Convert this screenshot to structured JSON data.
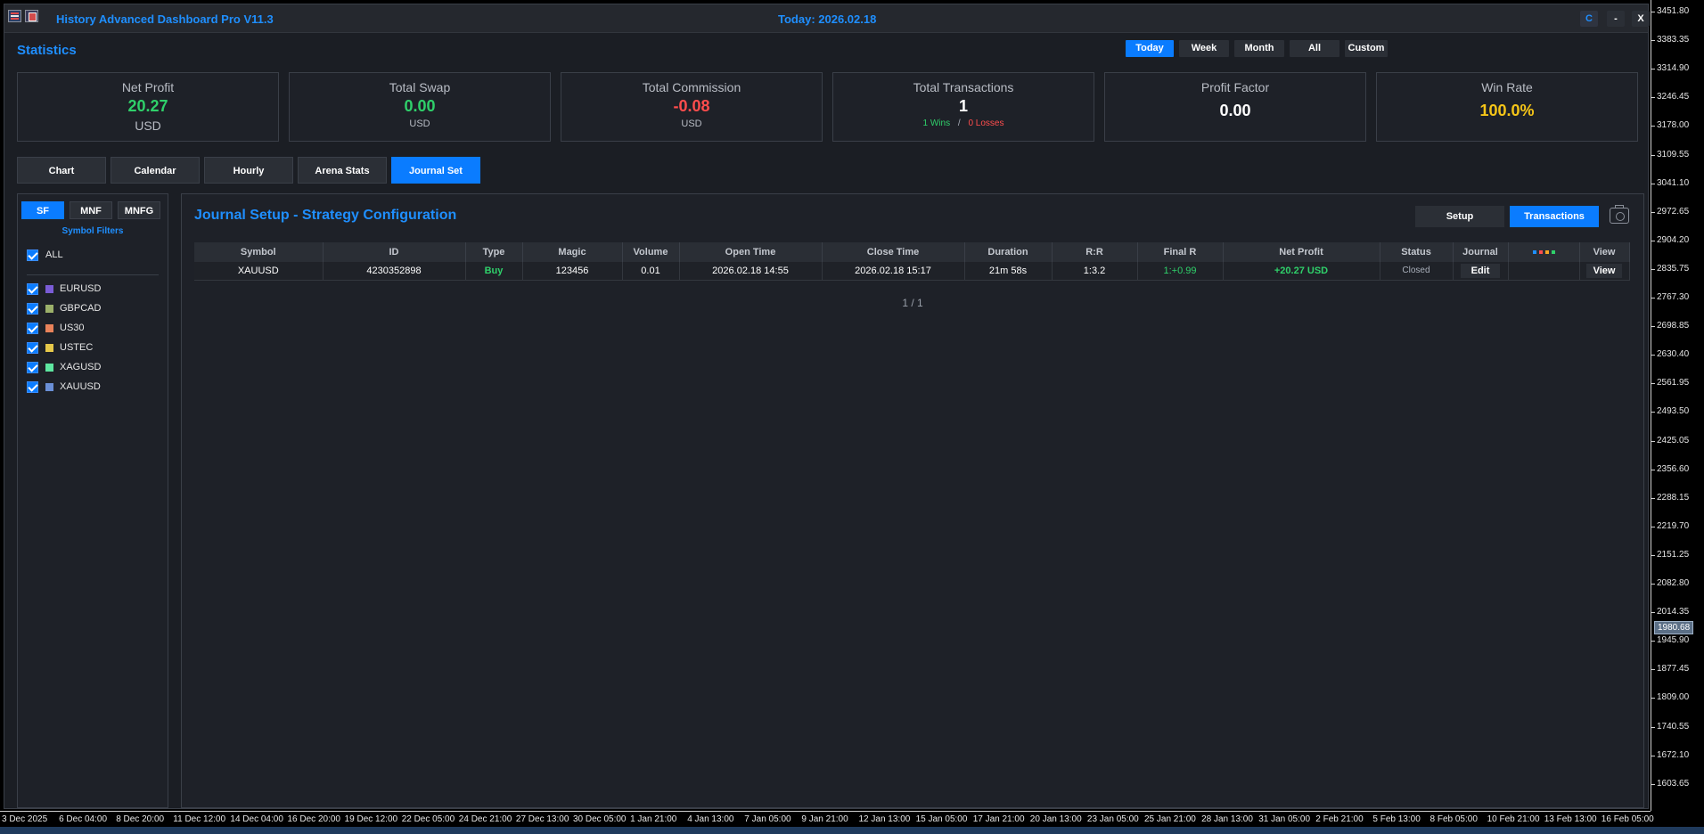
{
  "window": {
    "title": "History Advanced Dashboard Pro V11.3",
    "today": "Today: 2026.02.18",
    "btn_c": "C",
    "btn_min": "-",
    "btn_close": "X"
  },
  "statistics": {
    "heading": "Statistics",
    "periods": [
      "Today",
      "Week",
      "Month",
      "All",
      "Custom"
    ],
    "active_period": "Today",
    "cards": {
      "net_profit": {
        "title": "Net Profit",
        "value": "20.27",
        "unit": "USD"
      },
      "total_swap": {
        "title": "Total Swap",
        "value": "0.00",
        "unit": "USD"
      },
      "total_commission": {
        "title": "Total Commission",
        "value": "-0.08",
        "unit": "USD"
      },
      "total_transactions": {
        "title": "Total Transactions",
        "value": "1",
        "wins": "1 Wins",
        "separator": "/",
        "losses": "0 Losses"
      },
      "profit_factor": {
        "title": "Profit Factor",
        "value": "0.00"
      },
      "win_rate": {
        "title": "Win Rate",
        "value": "100.0%"
      }
    }
  },
  "main_tabs": [
    "Chart",
    "Calendar",
    "Hourly",
    "Arena Stats",
    "Journal Set"
  ],
  "active_tab": "Journal Set",
  "sidebar": {
    "filter_tabs": [
      "SF",
      "MNF",
      "MNFG"
    ],
    "active_filter": "SF",
    "label": "Symbol Filters",
    "all_label": "ALL",
    "symbols": [
      {
        "name": "EURUSD",
        "color": "#7a5cd6",
        "checked": true
      },
      {
        "name": "GBPCAD",
        "color": "#9bb06a",
        "checked": true
      },
      {
        "name": "US30",
        "color": "#e8825a",
        "checked": true
      },
      {
        "name": "USTEC",
        "color": "#e6c84a",
        "checked": true
      },
      {
        "name": "XAGUSD",
        "color": "#5ee6a0",
        "checked": true
      },
      {
        "name": "XAUUSD",
        "color": "#6a8fd6",
        "checked": true
      }
    ]
  },
  "journal": {
    "title": "Journal Setup - Strategy Configuration",
    "setup_button": "Setup",
    "transactions_button": "Transactions",
    "columns": [
      "Symbol",
      "ID",
      "Type",
      "Magic",
      "Volume",
      "Open Time",
      "Close Time",
      "Duration",
      "R:R",
      "Final R",
      "Net Profit",
      "Status",
      "Journal",
      "",
      "View"
    ],
    "header_dot_colors": [
      "#1f8fff",
      "#ff4d4d",
      "#f5a623",
      "#2fd06a"
    ],
    "rows": [
      {
        "symbol": "XAUUSD",
        "id": "4230352898",
        "type": "Buy",
        "magic": "123456",
        "volume": "0.01",
        "open_time": "2026.02.18 14:55",
        "close_time": "2026.02.18 15:17",
        "duration": "21m 58s",
        "rr": "1:3.2",
        "final_r": "1:+0.99",
        "net_profit": "+20.27 USD",
        "status": "Closed",
        "journal": "Edit",
        "view": "View"
      }
    ],
    "pagination": "1 / 1"
  },
  "chart": {
    "price_ticks": [
      "3451.80",
      "3383.35",
      "3314.90",
      "3246.45",
      "3178.00",
      "3109.55",
      "3041.10",
      "2972.65",
      "2904.20",
      "2835.75",
      "2767.30",
      "2698.85",
      "2630.40",
      "2561.95",
      "2493.50",
      "2425.05",
      "2356.60",
      "2288.15",
      "2219.70",
      "2151.25",
      "2082.80",
      "2014.35",
      "1945.90",
      "1877.45",
      "1809.00",
      "1740.55",
      "1672.10",
      "1603.65"
    ],
    "current_price": "1980.68",
    "time_ticks": [
      "3 Dec 2025",
      "6 Dec 04:00",
      "8 Dec 20:00",
      "11 Dec 12:00",
      "14 Dec 04:00",
      "16 Dec 20:00",
      "19 Dec 12:00",
      "22 Dec 05:00",
      "24 Dec 21:00",
      "27 Dec 13:00",
      "30 Dec 05:00",
      "1 Jan 21:00",
      "4 Jan 13:00",
      "7 Jan 05:00",
      "9 Jan 21:00",
      "12 Jan 13:00",
      "15 Jan 05:00",
      "17 Jan 21:00",
      "20 Jan 13:00",
      "23 Jan 05:00",
      "25 Jan 21:00",
      "28 Jan 13:00",
      "31 Jan 05:00",
      "2 Feb 21:00",
      "5 Feb 13:00",
      "8 Feb 05:00",
      "10 Feb 21:00",
      "13 Feb 13:00",
      "16 Feb 05:00"
    ]
  }
}
